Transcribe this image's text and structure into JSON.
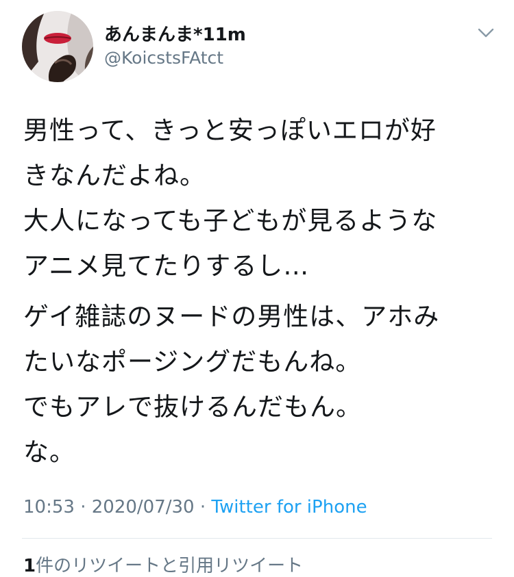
{
  "user": {
    "display_name": "あんまんま*11m",
    "handle": "@KoicstsFAtct"
  },
  "tweet": {
    "paragraphs": [
      [
        "男性って、きっと安っぽいエロが好",
        "きなんだよね。",
        "大人になっても子どもが見るような",
        "アニメ見てたりするし…"
      ],
      [
        "ゲイ雑誌のヌードの男性は、アホみ",
        "たいなポージングだもんね。",
        "でもアレで抜けるんだもん。",
        "な。"
      ]
    ],
    "time": "10:53",
    "separator": "·",
    "date": "2020/07/30",
    "source": "Twitter for iPhone"
  },
  "stats": {
    "retweet_count": "1",
    "retweet_label": "件のリツイートと引用リツイート"
  },
  "icons": {
    "avatar": "profile-photo",
    "menu": "chevron-down-icon"
  },
  "colors": {
    "text": "#14171a",
    "secondary": "#657786",
    "link": "#1da1f2",
    "divider": "#e1e8ed"
  }
}
